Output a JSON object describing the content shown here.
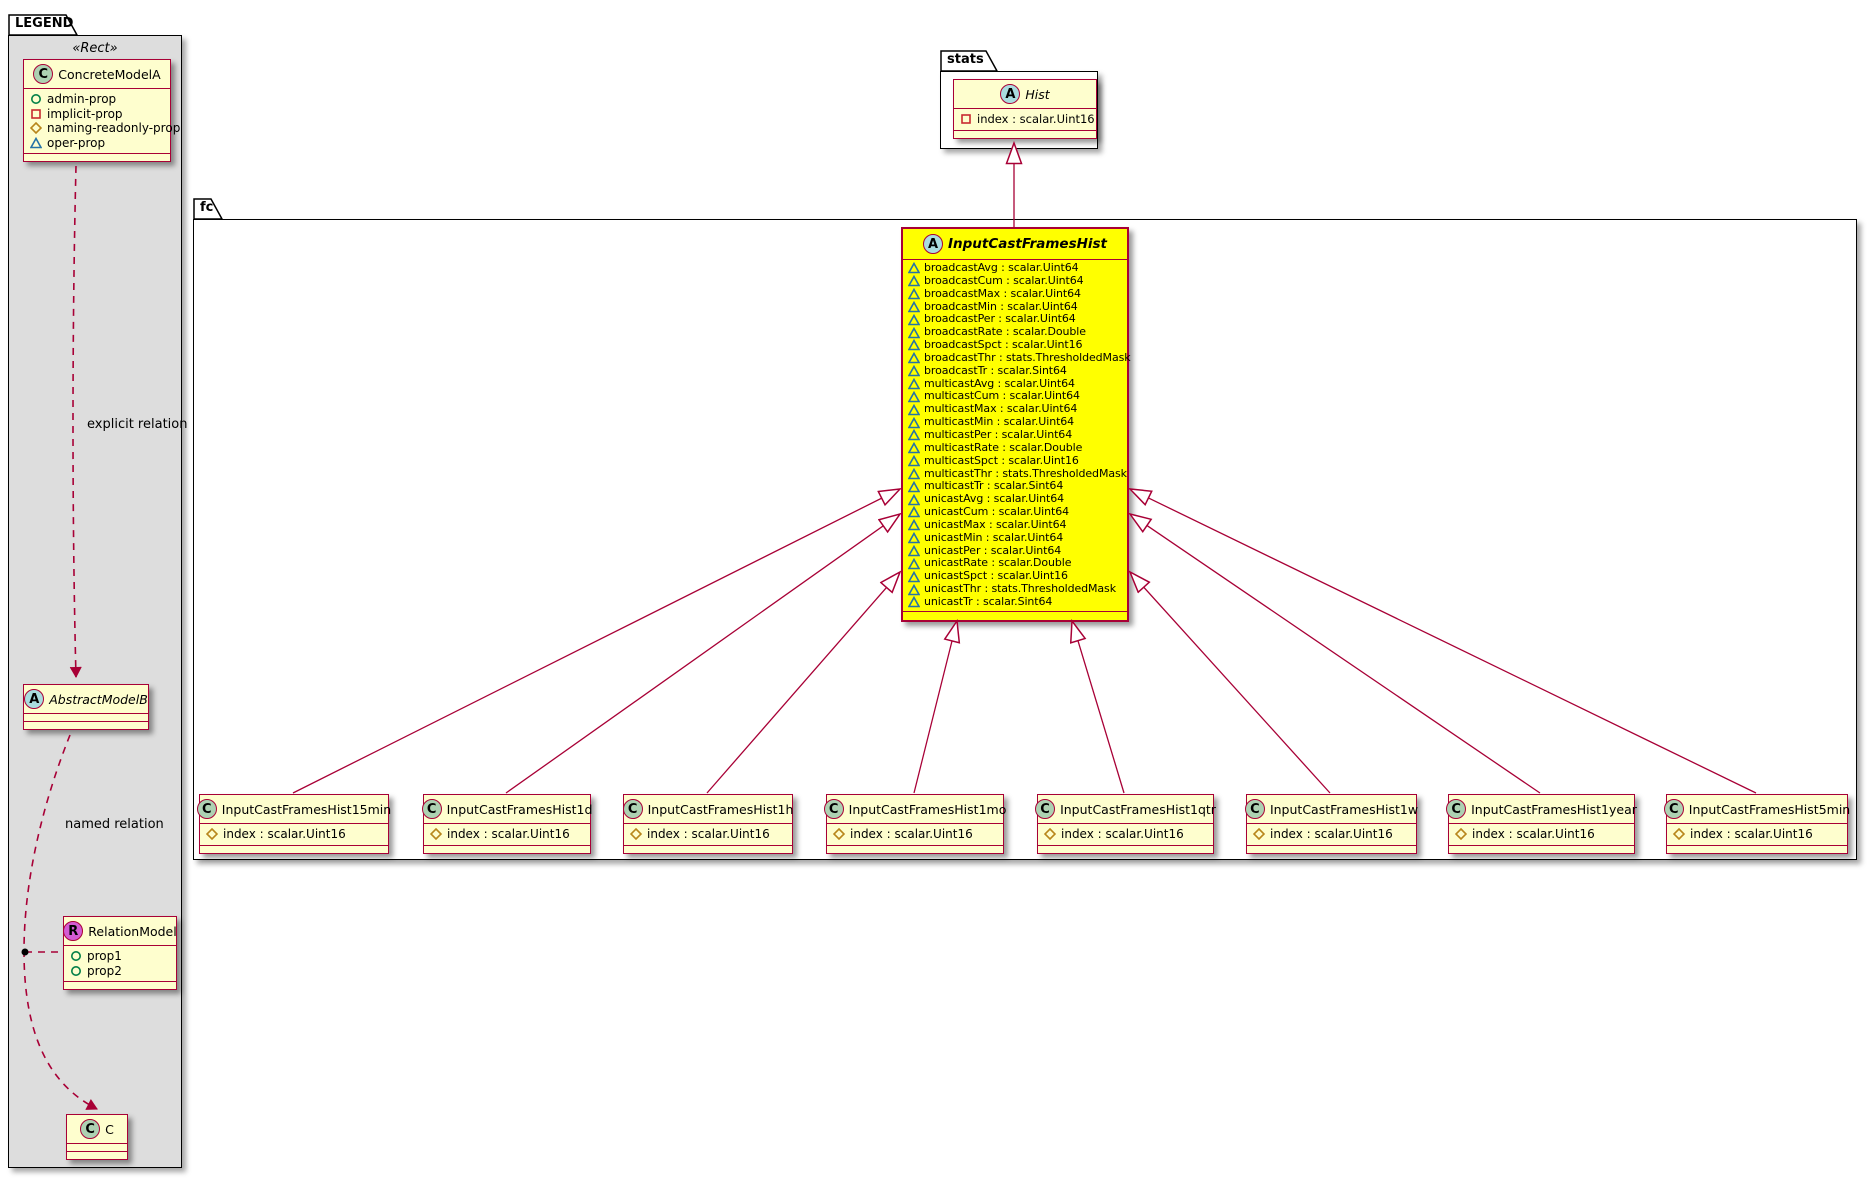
{
  "legend": {
    "title": "LEGEND",
    "stereotype": "«Rect»",
    "explicit_relation_label": "explicit relation",
    "named_relation_label": "named relation",
    "concrete": {
      "name": "ConcreteModelA",
      "spot": "C",
      "attrs": [
        {
          "icon": "circle",
          "label": "admin-prop"
        },
        {
          "icon": "square",
          "label": "implicit-prop"
        },
        {
          "icon": "diamond",
          "label": "naming-readonly-prop"
        },
        {
          "icon": "triangle",
          "label": "oper-prop"
        }
      ]
    },
    "abstract": {
      "name": "AbstractModelB",
      "spot": "A"
    },
    "relation": {
      "name": "RelationModel",
      "spot": "R",
      "attrs": [
        {
          "icon": "circle",
          "label": "prop1"
        },
        {
          "icon": "circle",
          "label": "prop2"
        }
      ]
    },
    "c_class": {
      "name": "C",
      "spot": "C"
    }
  },
  "stats": {
    "title": "stats",
    "hist": {
      "name": "Hist",
      "spot": "A",
      "attr": "index : scalar.Uint16"
    }
  },
  "fc": {
    "title": "fc",
    "parent": {
      "name": "InputCastFramesHist",
      "spot": "A",
      "attrs": [
        "broadcastAvg : scalar.Uint64",
        "broadcastCum : scalar.Uint64",
        "broadcastMax : scalar.Uint64",
        "broadcastMin : scalar.Uint64",
        "broadcastPer : scalar.Uint64",
        "broadcastRate : scalar.Double",
        "broadcastSpct : scalar.Uint16",
        "broadcastThr : stats.ThresholdedMask",
        "broadcastTr : scalar.Sint64",
        "multicastAvg : scalar.Uint64",
        "multicastCum : scalar.Uint64",
        "multicastMax : scalar.Uint64",
        "multicastMin : scalar.Uint64",
        "multicastPer : scalar.Uint64",
        "multicastRate : scalar.Double",
        "multicastSpct : scalar.Uint16",
        "multicastThr : stats.ThresholdedMask",
        "multicastTr : scalar.Sint64",
        "unicastAvg : scalar.Uint64",
        "unicastCum : scalar.Uint64",
        "unicastMax : scalar.Uint64",
        "unicastMin : scalar.Uint64",
        "unicastPer : scalar.Uint64",
        "unicastRate : scalar.Double",
        "unicastSpct : scalar.Uint16",
        "unicastThr : stats.ThresholdedMask",
        "unicastTr : scalar.Sint64"
      ]
    },
    "children": [
      {
        "name": "InputCastFramesHist15min",
        "spot": "C",
        "attr": "index : scalar.Uint16"
      },
      {
        "name": "InputCastFramesHist1d",
        "spot": "C",
        "attr": "index : scalar.Uint16"
      },
      {
        "name": "InputCastFramesHist1h",
        "spot": "C",
        "attr": "index : scalar.Uint16"
      },
      {
        "name": "InputCastFramesHist1mo",
        "spot": "C",
        "attr": "index : scalar.Uint16"
      },
      {
        "name": "InputCastFramesHist1qtr",
        "spot": "C",
        "attr": "index : scalar.Uint16"
      },
      {
        "name": "InputCastFramesHist1w",
        "spot": "C",
        "attr": "index : scalar.Uint16"
      },
      {
        "name": "InputCastFramesHist1year",
        "spot": "C",
        "attr": "index : scalar.Uint16"
      },
      {
        "name": "InputCastFramesHist5min",
        "spot": "C",
        "attr": "index : scalar.Uint16"
      }
    ]
  },
  "colors": {
    "accent": "#A80036",
    "class_fill": "#FEFECE",
    "highlight_fill": "#FFFF00",
    "legend_background": "#DDDDDD",
    "spot_class": "#ADD1B2",
    "spot_abstract": "#A9DCDF",
    "spot_relation": "#D35BD3",
    "icon_circle": "#038048",
    "icon_square": "#C82930",
    "icon_diamond": "#B8861B",
    "icon_triangle": "#2573A7"
  }
}
